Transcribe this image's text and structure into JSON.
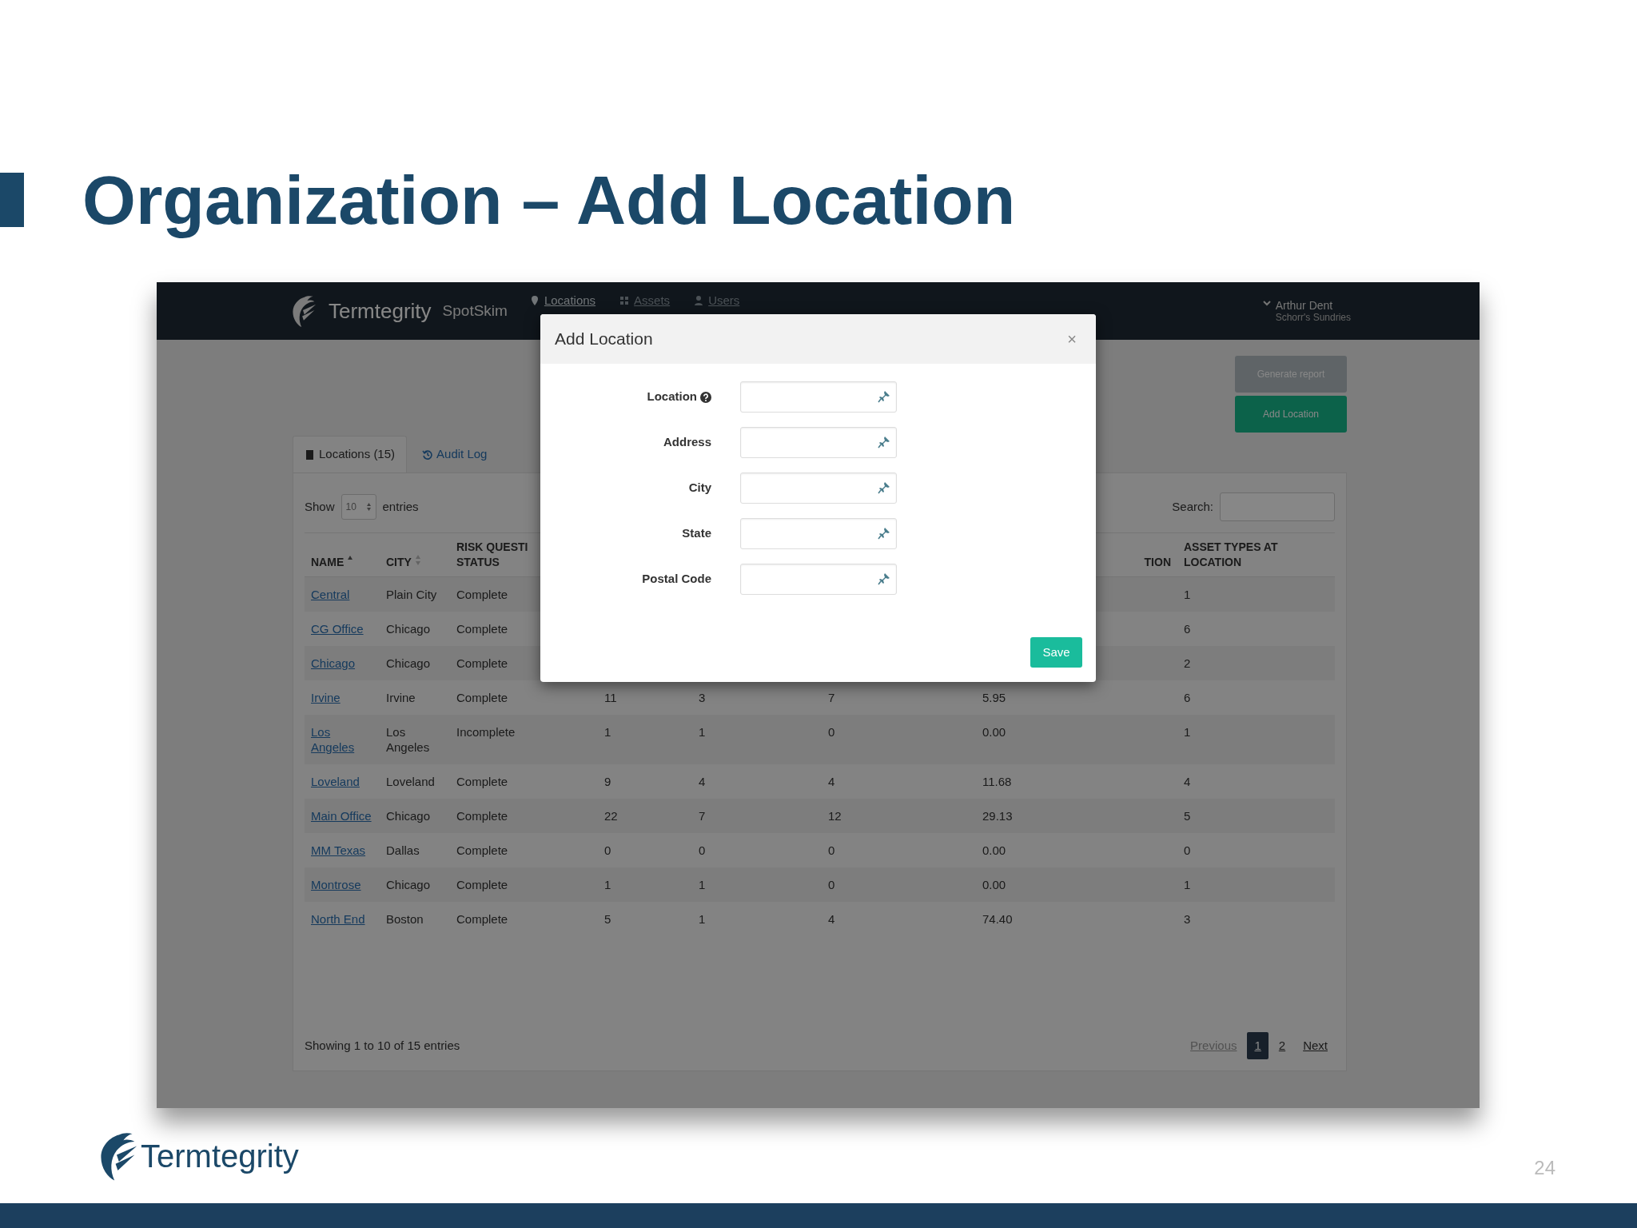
{
  "slide": {
    "title": "Organization – Add Location",
    "footer_logo": "Termtegrity",
    "page_number": "24"
  },
  "app": {
    "navbar": {
      "brand": "Termtegrity",
      "product": "SpotSkim",
      "nav": [
        {
          "label": "Locations",
          "selected": true
        },
        {
          "label": "Assets",
          "selected": false
        },
        {
          "label": "Users",
          "selected": false
        }
      ],
      "user": {
        "name": "Arthur Dent",
        "org": "Schorr's Sundries"
      }
    },
    "actions": [
      {
        "label": "Generate report",
        "kind": "secondary"
      },
      {
        "label": "Add Location",
        "kind": "success"
      }
    ],
    "tabs": [
      {
        "label": "Locations (15)",
        "selected": true
      },
      {
        "label": "Audit Log",
        "selected": false
      }
    ],
    "controls": {
      "show_label": "Show",
      "page_size": "10",
      "entries_label": "entries",
      "search_label": "Search:"
    },
    "table": {
      "columns": [
        {
          "label": "NAME",
          "sorted": true
        },
        {
          "label": "CITY",
          "sorted": false
        },
        {
          "label": "RISK QUESTI STATUS"
        },
        null,
        null,
        null,
        {
          "label": "TION"
        },
        {
          "label": "ASSET TYPES AT LOCATION"
        }
      ],
      "rows": [
        {
          "name": "Central",
          "city": "Plain City",
          "status": "Complete",
          "asset_types": "1"
        },
        {
          "name": "CG Office",
          "city": "Chicago",
          "status": "Complete",
          "asset_types": "6"
        },
        {
          "name": "Chicago",
          "city": "Chicago",
          "status": "Complete",
          "asset_types": "2"
        },
        {
          "name": "Irvine",
          "city": "Irvine",
          "status": "Complete",
          "values": [
            "11",
            "3",
            "7",
            "5.95"
          ],
          "asset_types": "6"
        },
        {
          "name": "Los Angeles",
          "city": "Los Angeles",
          "status": "Incomplete",
          "values": [
            "1",
            "1",
            "0",
            "0.00"
          ],
          "asset_types": "1"
        },
        {
          "name": "Loveland",
          "city": "Loveland",
          "status": "Complete",
          "values": [
            "9",
            "4",
            "4",
            "11.68"
          ],
          "asset_types": "4"
        },
        {
          "name": "Main Office",
          "city": "Chicago",
          "status": "Complete",
          "values": [
            "22",
            "7",
            "12",
            "29.13"
          ],
          "asset_types": "5"
        },
        {
          "name": "MM Texas",
          "city": "Dallas",
          "status": "Complete",
          "values": [
            "0",
            "0",
            "0",
            "0.00"
          ],
          "asset_types": "0"
        },
        {
          "name": "Montrose",
          "city": "Chicago",
          "status": "Complete",
          "values": [
            "1",
            "1",
            "0",
            "0.00"
          ],
          "asset_types": "1"
        },
        {
          "name": "North End",
          "city": "Boston",
          "status": "Complete",
          "values": [
            "5",
            "1",
            "4",
            "74.40"
          ],
          "asset_types": "3"
        }
      ]
    },
    "footer": {
      "info": "Showing 1 to 10 of 15 entries",
      "previous": {
        "label": "Previous",
        "disabled": true
      },
      "pages": [
        {
          "label": "1",
          "selected": true
        },
        {
          "label": "2",
          "selected": false
        }
      ],
      "next": {
        "label": "Next",
        "disabled": false
      }
    },
    "modal": {
      "title": "Add Location",
      "close": "×",
      "fields": [
        {
          "label": "Location",
          "help": true
        },
        {
          "label": "Address",
          "help": false
        },
        {
          "label": "City",
          "help": false
        },
        {
          "label": "State",
          "help": false
        },
        {
          "label": "Postal Code",
          "help": false
        }
      ],
      "save": "Save"
    }
  }
}
